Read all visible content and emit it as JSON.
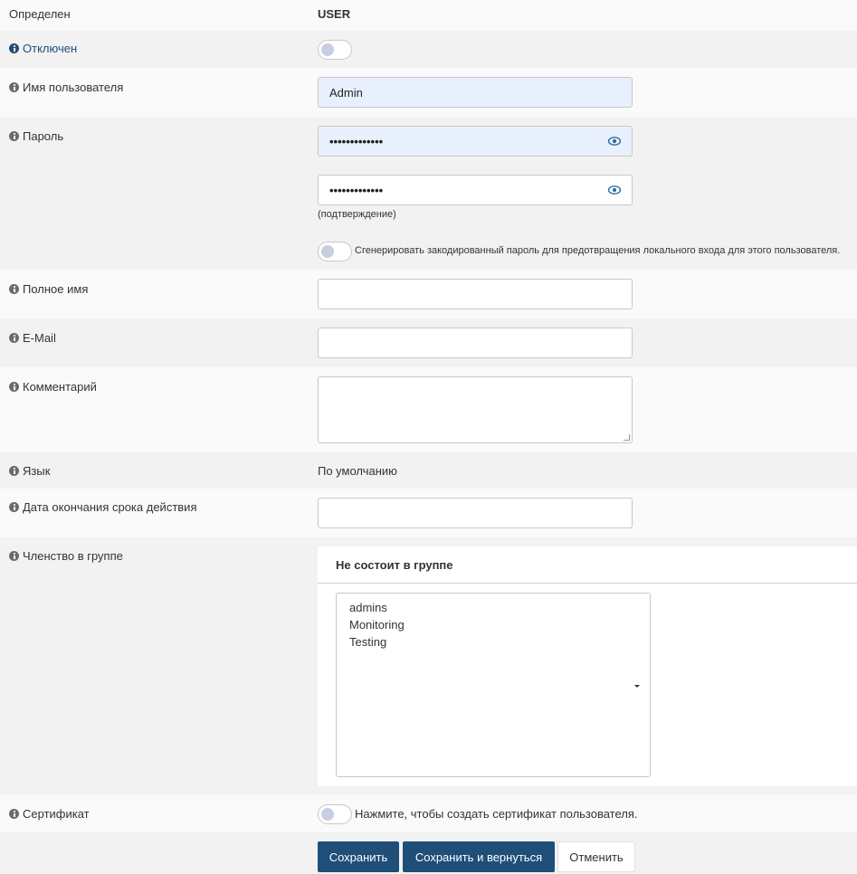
{
  "defined": {
    "label": "Определен",
    "value": "USER"
  },
  "disabled": {
    "label": "Отключен",
    "checked": false
  },
  "username": {
    "label": "Имя пользователя",
    "value": "Admin"
  },
  "password": {
    "label": "Пароль",
    "value_masked": "•••••••••••••",
    "confirm_masked": "•••••••••••••",
    "confirm_hint": "(подтверждение)",
    "scramble_label": "Сгенерировать закодированный пароль для предотвращения локального входа для этого пользователя.",
    "scramble_checked": false
  },
  "fullname": {
    "label": "Полное имя",
    "value": ""
  },
  "email": {
    "label": "E-Mail",
    "value": ""
  },
  "comment": {
    "label": "Комментарий",
    "value": ""
  },
  "language": {
    "label": "Язык",
    "value": "По умолчанию"
  },
  "expires": {
    "label": "Дата окончания срока действия",
    "value": ""
  },
  "groups": {
    "label": "Членство в группе",
    "panel_title": "Не состоит в группе",
    "items": [
      "admins",
      "Monitoring",
      "Testing"
    ]
  },
  "certificate": {
    "label": "Сертификат",
    "hint": "Нажмите, чтобы создать сертификат пользователя.",
    "checked": false
  },
  "buttons": {
    "save": "Сохранить",
    "save_return": "Сохранить и вернуться",
    "cancel": "Отменить"
  },
  "colors": {
    "primary": "#1f4e79",
    "toggle_knob": "#c9cde0",
    "autofill_bg": "#e8f0fe"
  },
  "icons": {
    "info": "info-circle-icon",
    "eye": "eye-icon"
  }
}
